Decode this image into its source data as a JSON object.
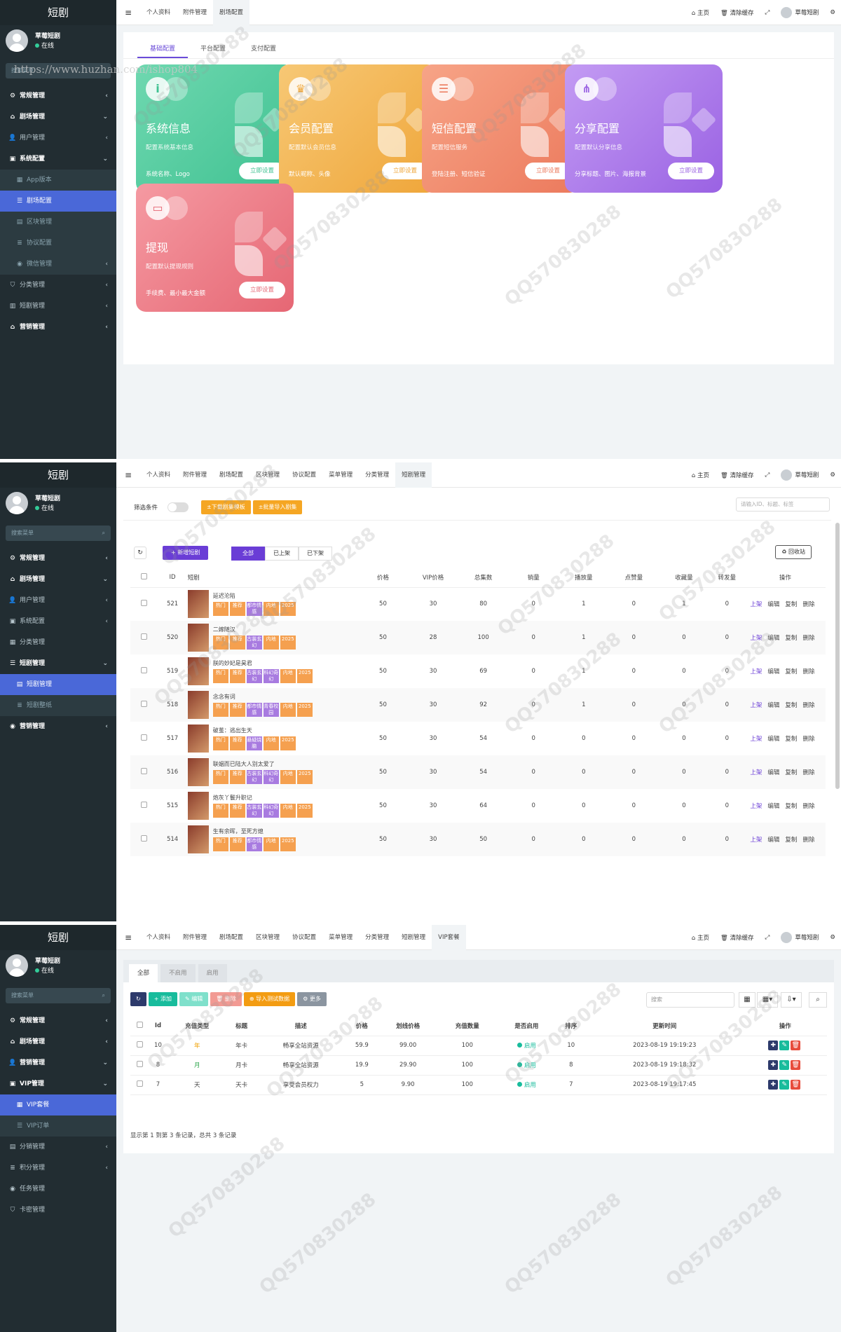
{
  "app": {
    "logo": "短剧",
    "user_name": "草莓短剧",
    "user_status": "在线",
    "search_placeholder": "搜索菜单",
    "url_watermark": "https://www.huzhan.com/ishop804"
  },
  "watermarks": {
    "qq": "QQ570830288"
  },
  "topbar": {
    "home": "主页",
    "clear_cache": "清除缓存",
    "user": "草莓短剧"
  },
  "s1": {
    "tabs": [
      "个人资料",
      "附件管理",
      "剧场配置"
    ],
    "menu": [
      {
        "label": "常规管理",
        "type": "b",
        "arrow": "‹"
      },
      {
        "label": "剧场管理",
        "type": "b",
        "arrow": "⌄"
      },
      {
        "label": "用户管理",
        "type": "s",
        "arrow": "‹"
      },
      {
        "label": "系统配置",
        "type": "b",
        "arrow": "⌄"
      },
      {
        "label": "App版本",
        "type": "s2",
        "arrow": ""
      },
      {
        "label": "剧场配置",
        "type": "act",
        "arrow": ""
      },
      {
        "label": "区块管理",
        "type": "s2",
        "arrow": ""
      },
      {
        "label": "协议配置",
        "type": "s2",
        "arrow": ""
      },
      {
        "label": "微信管理",
        "type": "s2",
        "arrow": "‹"
      },
      {
        "label": "分类管理",
        "type": "s",
        "arrow": "‹"
      },
      {
        "label": "短剧管理",
        "type": "s",
        "arrow": "‹"
      },
      {
        "label": "营销管理",
        "type": "b",
        "arrow": "‹"
      }
    ],
    "subtabs": [
      "基础配置",
      "平台配置",
      "支付配置"
    ],
    "cards": [
      {
        "title": "系统信息",
        "desc": "配置系统基本信息",
        "foot": "系统名称、Logo",
        "btn": "立即设置",
        "icon": "i",
        "c1": "#6fd8b0",
        "c2": "#3fc191"
      },
      {
        "title": "会员配置",
        "desc": "配置默认会员信息",
        "foot": "默认昵称、头像",
        "btn": "立即设置",
        "icon": "♛",
        "c1": "#f7c875",
        "c2": "#efa63a"
      },
      {
        "title": "短信配置",
        "desc": "配置短信服务",
        "foot": "登陆注册、短信验证",
        "btn": "立即设置",
        "icon": "☰",
        "c1": "#f7a487",
        "c2": "#ec7a5d"
      },
      {
        "title": "分享配置",
        "desc": "配置默认分享信息",
        "foot": "分享标题、图片、海报背景",
        "btn": "立即设置",
        "icon": "⋔",
        "c1": "#c39bf3",
        "c2": "#9a62e3"
      },
      {
        "title": "提现",
        "desc": "配置默认提现规则",
        "foot": "手续费、最小最大金额",
        "btn": "立即设置",
        "icon": "▭",
        "c1": "#f59aa2",
        "c2": "#e66774"
      }
    ]
  },
  "s2": {
    "tabs": [
      "个人资料",
      "附件管理",
      "剧场配置",
      "区块管理",
      "协议配置",
      "菜单管理",
      "分类管理",
      "短剧管理"
    ],
    "menu": [
      {
        "label": "常规管理",
        "type": "b",
        "arrow": "‹"
      },
      {
        "label": "剧场管理",
        "type": "b",
        "arrow": "⌄"
      },
      {
        "label": "用户管理",
        "type": "s",
        "arrow": "‹"
      },
      {
        "label": "系统配置",
        "type": "s",
        "arrow": "‹"
      },
      {
        "label": "分类管理",
        "type": "s",
        "arrow": ""
      },
      {
        "label": "短剧管理",
        "type": "b",
        "arrow": "⌄"
      },
      {
        "label": "短剧管理",
        "type": "act",
        "arrow": ""
      },
      {
        "label": "短剧整纸",
        "type": "s2",
        "arrow": ""
      },
      {
        "label": "营销管理",
        "type": "b",
        "arrow": "‹"
      }
    ],
    "filter_label": "筛选条件",
    "btn_download": "±下载剧集模板",
    "btn_import": "±批量导入剧集",
    "search_placeholder": "请输入ID、标题、标签",
    "btn_add": "+ 新增短剧",
    "seg": [
      "全部",
      "已上架",
      "已下架"
    ],
    "btn_recycle": "♻ 回收站",
    "columns": [
      "ID",
      "短剧",
      "价格",
      "VIP价格",
      "总集数",
      "销量",
      "播放量",
      "点赞量",
      "收藏量",
      "转发量",
      "操作"
    ],
    "ops": [
      "上架",
      "编辑",
      "复制",
      "删除"
    ],
    "rows": [
      {
        "id": "521",
        "title": "延迟沦陷",
        "tags": [
          "热门",
          "推荐",
          "都市情感",
          "内地",
          "2025"
        ],
        "price": "50",
        "vip": "30",
        "eps": "80",
        "sales": "0",
        "plays": "1",
        "likes": "0",
        "favs": "1",
        "shares": "0"
      },
      {
        "id": "520",
        "title": "二嫁随汉",
        "tags": [
          "热门",
          "推荐",
          "古装玄幻",
          "内地",
          "2025"
        ],
        "price": "50",
        "vip": "28",
        "eps": "100",
        "sales": "0",
        "plays": "1",
        "likes": "0",
        "favs": "0",
        "shares": "0"
      },
      {
        "id": "519",
        "title": "朕的妙妃是昊君",
        "tags": [
          "热门",
          "推荐",
          "古装玄幻",
          "科幻奇幻",
          "内地",
          "2025"
        ],
        "price": "50",
        "vip": "30",
        "eps": "69",
        "sales": "0",
        "plays": "1",
        "likes": "0",
        "favs": "0",
        "shares": "0"
      },
      {
        "id": "518",
        "title": "念念有词",
        "tags": [
          "热门",
          "推荐",
          "都市情感",
          "青春校园",
          "内地",
          "2025"
        ],
        "price": "50",
        "vip": "30",
        "eps": "92",
        "sales": "0",
        "plays": "1",
        "likes": "0",
        "favs": "0",
        "shares": "0"
      },
      {
        "id": "517",
        "title": "破茧：逃出生天",
        "tags": [
          "热门",
          "推荐",
          "悬疑烧脑",
          "内地",
          "2025"
        ],
        "price": "50",
        "vip": "30",
        "eps": "54",
        "sales": "0",
        "plays": "0",
        "likes": "0",
        "favs": "0",
        "shares": "0"
      },
      {
        "id": "516",
        "title": "联姻而已陆大人别太爱了",
        "tags": [
          "热门",
          "推荐",
          "古装玄幻",
          "科幻奇幻",
          "内地",
          "2025"
        ],
        "price": "50",
        "vip": "30",
        "eps": "54",
        "sales": "0",
        "plays": "0",
        "likes": "0",
        "favs": "0",
        "shares": "0"
      },
      {
        "id": "515",
        "title": "炮灰丫鬟升职记",
        "tags": [
          "热门",
          "推荐",
          "古装玄幻",
          "科幻奇幻",
          "内地",
          "2025"
        ],
        "price": "50",
        "vip": "30",
        "eps": "64",
        "sales": "0",
        "plays": "0",
        "likes": "0",
        "favs": "0",
        "shares": "0"
      },
      {
        "id": "514",
        "title": "生有余晖，至死方熄",
        "tags": [
          "热门",
          "推荐",
          "都市情感",
          "内地",
          "2025"
        ],
        "price": "50",
        "vip": "30",
        "eps": "50",
        "sales": "0",
        "plays": "0",
        "likes": "0",
        "favs": "0",
        "shares": "0"
      }
    ]
  },
  "s3": {
    "tabs": [
      "个人资料",
      "附件管理",
      "剧场配置",
      "区块管理",
      "协议配置",
      "菜单管理",
      "分类管理",
      "短剧管理",
      "VIP套餐"
    ],
    "menu": [
      {
        "label": "常规管理",
        "type": "b",
        "arrow": "‹"
      },
      {
        "label": "剧场管理",
        "type": "b",
        "arrow": "‹"
      },
      {
        "label": "营销管理",
        "type": "b",
        "arrow": "⌄"
      },
      {
        "label": "VIP管理",
        "type": "b",
        "arrow": "⌄"
      },
      {
        "label": "VIP套餐",
        "type": "act",
        "arrow": ""
      },
      {
        "label": "VIP订单",
        "type": "s2",
        "arrow": ""
      },
      {
        "label": "分销管理",
        "type": "s",
        "arrow": "‹"
      },
      {
        "label": "积分管理",
        "type": "s",
        "arrow": "‹"
      },
      {
        "label": "任务管理",
        "type": "s",
        "arrow": ""
      },
      {
        "label": "卡密管理",
        "type": "s",
        "arrow": ""
      }
    ],
    "seg": [
      "全部",
      "不启用",
      "启用"
    ],
    "toolbar": {
      "add": "+ 添加",
      "edit": "✎ 编辑",
      "del": "🗑 删除",
      "import": "⊕ 导入测试数据",
      "more": "⚙ 更多",
      "search": "搜索"
    },
    "columns": [
      "Id",
      "充值类型",
      "标题",
      "描述",
      "价格",
      "划线价格",
      "充值数量",
      "是否启用",
      "排序",
      "更新时间",
      "操作"
    ],
    "rows": [
      {
        "id": "10",
        "type": "年",
        "tcolor": "#f0a000",
        "title": "年卡",
        "desc": "畅享全站资源",
        "price": "59.9",
        "orig": "99.00",
        "qty": "100",
        "status": "启用",
        "sort": "10",
        "time": "2023-08-19 19:19:23"
      },
      {
        "id": "8",
        "type": "月",
        "tcolor": "#2aa54a",
        "title": "月卡",
        "desc": "畅享全站资源",
        "price": "19.9",
        "orig": "29.90",
        "qty": "100",
        "status": "启用",
        "sort": "8",
        "time": "2023-08-19 19:18:32"
      },
      {
        "id": "7",
        "type": "天",
        "tcolor": "#444",
        "title": "天卡",
        "desc": "享受会员权力",
        "price": "5",
        "orig": "9.90",
        "qty": "100",
        "status": "启用",
        "sort": "7",
        "time": "2023-08-19 19:17:45"
      }
    ],
    "footer": "显示第 1 到第 3 条记录，总共 3 条记录"
  }
}
